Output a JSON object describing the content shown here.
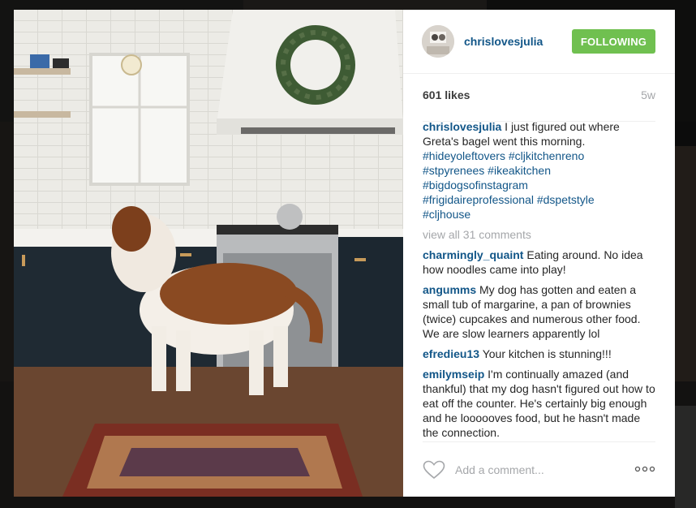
{
  "post": {
    "username": "chrislovesjulia",
    "follow_label": "FOLLOWING",
    "likes": "601 likes",
    "age": "5w",
    "caption_lines": [
      "I just figured out where",
      "Greta's bagel went this morning."
    ],
    "hashtags": [
      "#hideyoleftovers",
      "#cljkitchenreno",
      "#stpyrenees",
      "#ikeakitchen",
      "#bigdogsofinstagram",
      "#frigidaireprofessional",
      "#dspetstyle",
      "#cljhouse"
    ],
    "view_all": "view all 31 comments",
    "comments": [
      {
        "user": "charmingly_quaint",
        "text": "Eating around. No idea how noodles came into play!"
      },
      {
        "user": "angumms",
        "text": "My dog has gotten and eaten a small tub of margarine, a pan of brownies (twice) cupcakes and numerous other food. We are slow learners apparently lol"
      },
      {
        "user": "efredieu13",
        "text": "Your kitchen is stunning!!!"
      },
      {
        "user": "emilymseip",
        "text": "I'm continually amazed (and thankful) that my dog hasn't figured out how to eat off the counter. He's certainly big enough and he loooooves food, but he hasn't made the connection."
      }
    ],
    "comment_placeholder": "Add a comment...",
    "heart_icon": "heart-outline-icon",
    "more_icon": "more-options-icon"
  },
  "colors": {
    "link": "#125688",
    "following_bg": "#70c050",
    "muted": "#a5a7aa"
  }
}
